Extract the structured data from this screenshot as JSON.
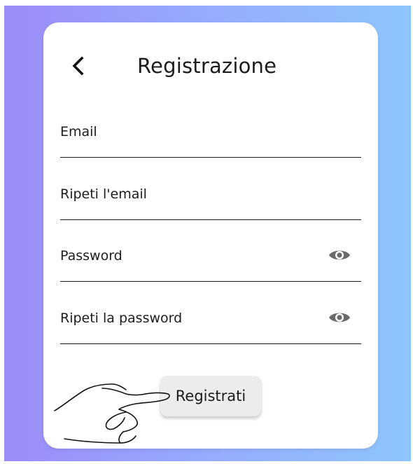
{
  "header": {
    "title": "Registrazione",
    "back_icon": "chevron-left-icon"
  },
  "form": {
    "fields": [
      {
        "label": "Email",
        "type": "email",
        "value": ""
      },
      {
        "label": "Ripeti l'email",
        "type": "email",
        "value": ""
      },
      {
        "label": "Password",
        "type": "password",
        "value": "",
        "trailing_icon": "eye-icon"
      },
      {
        "label": "Ripeti la password",
        "type": "password",
        "value": "",
        "trailing_icon": "eye-icon"
      }
    ],
    "submit_label": "Registrati"
  },
  "colors": {
    "background_gradient": [
      "#9b8cf8",
      "#95aefc",
      "#8ec5fd"
    ],
    "card": "#ffffff",
    "text": "#1c1c1e",
    "underline": "#1a1a1a",
    "icon": "#6b6b6b",
    "button": "#ececec"
  },
  "overlay": {
    "pointer_icon": "hand-pointer-icon"
  }
}
